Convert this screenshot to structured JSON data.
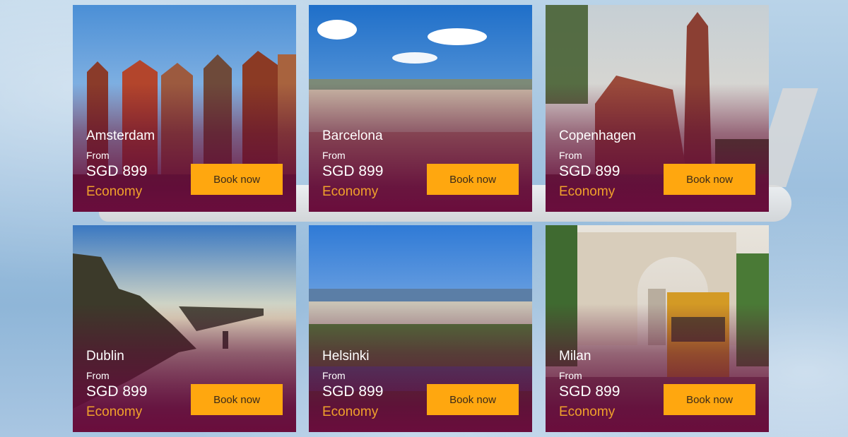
{
  "cards": [
    {
      "city": "Amsterdam",
      "from": "From",
      "price": "SGD 899",
      "cabin": "Economy",
      "button": "Book now"
    },
    {
      "city": "Barcelona",
      "from": "From",
      "price": "SGD 899",
      "cabin": "Economy",
      "button": "Book now"
    },
    {
      "city": "Copenhagen",
      "from": "From",
      "price": "SGD 899",
      "cabin": "Economy",
      "button": "Book now"
    },
    {
      "city": "Dublin",
      "from": "From",
      "price": "SGD 899",
      "cabin": "Economy",
      "button": "Book now"
    },
    {
      "city": "Helsinki",
      "from": "From",
      "price": "SGD 899",
      "cabin": "Economy",
      "button": "Book now"
    },
    {
      "city": "Milan",
      "from": "From",
      "price": "SGD 899",
      "cabin": "Economy",
      "button": "Book now"
    }
  ],
  "colors": {
    "button": "#ffa70f",
    "cabin": "#f0a12b",
    "overlay": "#6a0d3c"
  },
  "background": {
    "description_icon": "airplane-icon"
  }
}
